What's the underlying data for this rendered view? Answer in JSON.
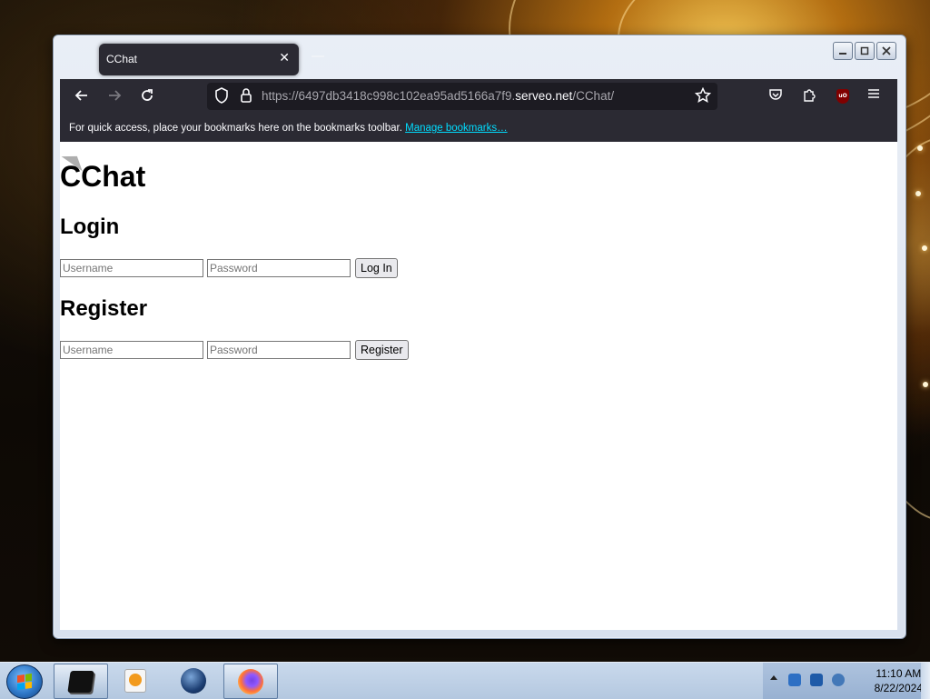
{
  "browser": {
    "tab_title": "CChat",
    "tab_close_glyph": "✕",
    "url_prefix": "https://6497db3418c998c102ea95ad5166a7f9.",
    "url_domain": "serveo.net",
    "url_path": "/CChat/",
    "bookmarks_message": "For quick access, place your bookmarks here on the bookmarks toolbar.",
    "bookmarks_link": "Manage bookmarks…",
    "icons": [
      "back-icon",
      "forward-icon",
      "reload-icon",
      "shield-icon",
      "lock-icon",
      "star-icon",
      "pocket-icon",
      "extensions-icon",
      "ublock-icon",
      "menu-icon"
    ]
  },
  "page": {
    "title": "CChat",
    "login": {
      "heading": "Login",
      "username_placeholder": "Username",
      "password_placeholder": "Password",
      "button": "Log In"
    },
    "register": {
      "heading": "Register",
      "username_placeholder": "Username",
      "password_placeholder": "Password",
      "button": "Register"
    }
  },
  "taskbar": {
    "apps": [
      "terminal-icon",
      "media-player-icon",
      "globe-icon",
      "firefox-icon"
    ],
    "clock_time": "11:10 AM",
    "clock_date": "8/22/2024"
  }
}
